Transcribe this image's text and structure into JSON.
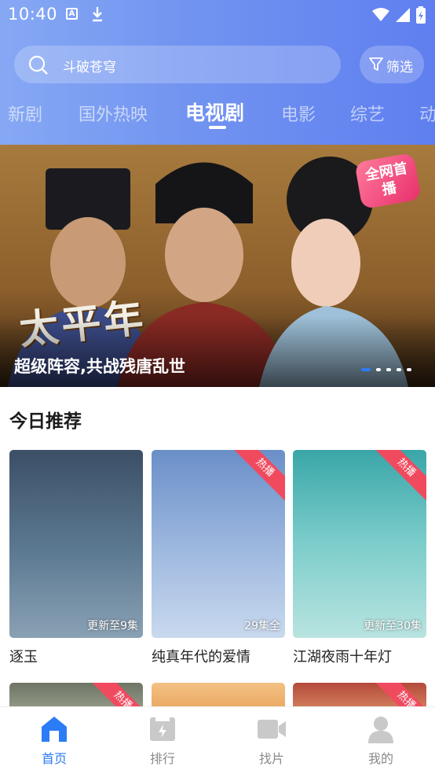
{
  "status_bar": {
    "time": "10:40",
    "icons": [
      "a-notification-icon",
      "download-icon",
      "wifi-icon",
      "signal-icon",
      "battery-icon"
    ]
  },
  "search": {
    "text": "斗破苍穹",
    "icon": "search-icon"
  },
  "filter": {
    "label": "筛选",
    "icon": "filter-icon"
  },
  "tabs": [
    {
      "label": "新剧",
      "active": false
    },
    {
      "label": "国外热映",
      "active": false
    },
    {
      "label": "电视剧",
      "active": true
    },
    {
      "label": "电影",
      "active": false
    },
    {
      "label": "综艺",
      "active": false
    },
    {
      "label": "动",
      "active": false
    }
  ],
  "banner": {
    "caption": "超级阵容,共战残唐乱世",
    "art_title": "太平年",
    "badge": "全网首播",
    "slides": 5,
    "active_slide": 1
  },
  "section": {
    "title": "今日推荐"
  },
  "cards": [
    {
      "name": "逐玉",
      "episode": "更新至9集",
      "hot": false,
      "colors": [
        "#3b4f66",
        "#8aa1b4"
      ]
    },
    {
      "name": "纯真年代的爱情",
      "episode": "29集全",
      "hot": true,
      "hot_label": "热播",
      "colors": [
        "#6a8fc8",
        "#c9d9ee"
      ]
    },
    {
      "name": "江湖夜雨十年灯",
      "episode": "更新至30集",
      "hot": true,
      "hot_label": "热播",
      "colors": [
        "#3aa6a8",
        "#b9e4e0"
      ]
    }
  ],
  "row2_cards": [
    {
      "hot": true,
      "hot_label": "热播"
    },
    {
      "hot": false
    },
    {
      "hot": true,
      "hot_label": "热播"
    }
  ],
  "nav": [
    {
      "label": "首页",
      "icon": "home-icon",
      "active": true
    },
    {
      "label": "排行",
      "icon": "ranking-icon",
      "active": false
    },
    {
      "label": "找片",
      "icon": "video-camera-icon",
      "active": false
    },
    {
      "label": "我的",
      "icon": "user-icon",
      "active": false
    }
  ],
  "colors": {
    "accent": "#2b7cf6",
    "header_start": "#86a8f4",
    "header_end": "#5f7ff0",
    "hot": "#f04a5f"
  }
}
